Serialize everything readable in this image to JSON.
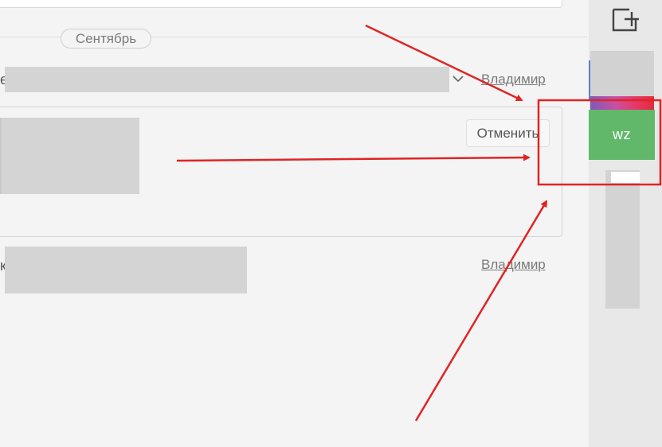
{
  "timeline": {
    "month_label": "Сентябрь"
  },
  "entries": [
    {
      "author": "Владимир",
      "prefix": "е"
    },
    {
      "author": "Владимир",
      "prefix": "к"
    }
  ],
  "card": {
    "cancel_label": "Отменить"
  },
  "sidebar": {
    "new_icon": "new-window-plus-icon",
    "active_user_initials": "wz",
    "active_user_color": "#61b86a"
  },
  "colors": {
    "annotation": "#e02424",
    "background": "#f4f4f4",
    "sidebar_background": "#e8e8e8",
    "redaction": "#d4d4d5"
  }
}
